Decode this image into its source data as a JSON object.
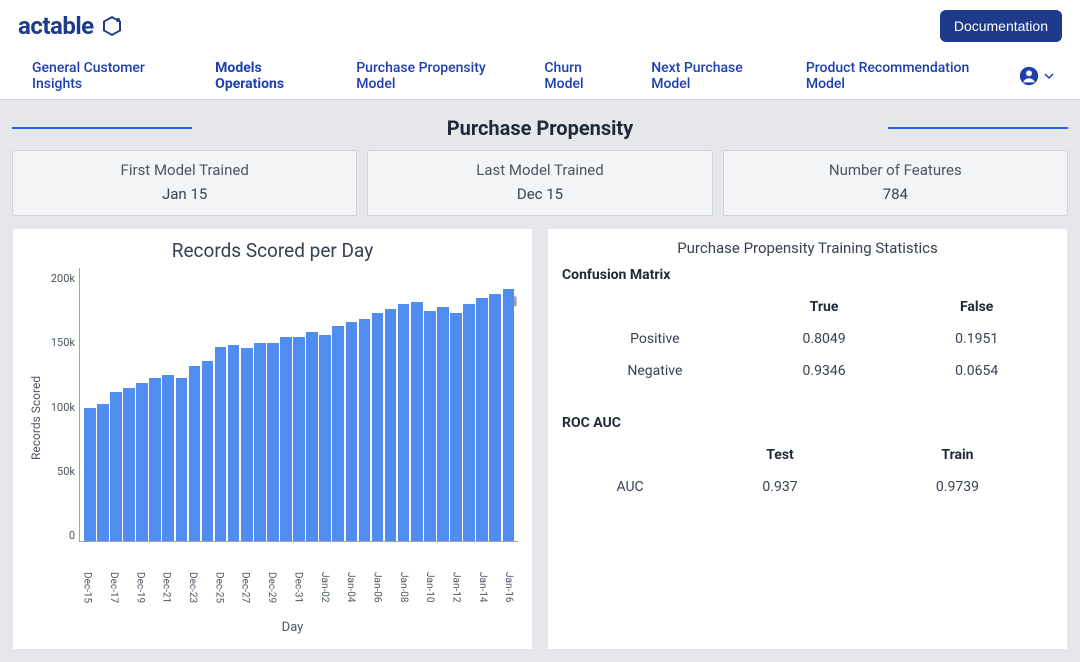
{
  "brand": "actable",
  "doc_button": "Documentation",
  "nav": [
    "General Customer Insights",
    "Models Operations",
    "Purchase Propensity Model",
    "Churn Model",
    "Next Purchase Model",
    "Product Recommendation Model"
  ],
  "nav_active_index": 1,
  "section_title": "Purchase Propensity",
  "stats": [
    {
      "label": "First Model Trained",
      "value": "Jan 15"
    },
    {
      "label": "Last Model Trained",
      "value": "Dec 15"
    },
    {
      "label": "Number of Features",
      "value": "784"
    }
  ],
  "chart_title": "Records Scored per Day",
  "chart_ylabel": "Records Scored",
  "chart_xlabel": "Day",
  "chart_y_ticks": [
    "200k",
    "150k",
    "100k",
    "50k",
    "0"
  ],
  "chart_data": {
    "type": "bar",
    "title": "Records Scored per Day",
    "xlabel": "Day",
    "ylabel": "Records Scored",
    "ylim": [
      0,
      210000
    ],
    "categories": [
      "Dec-15",
      "Dec-16",
      "Dec-17",
      "Dec-18",
      "Dec-19",
      "Dec-20",
      "Dec-21",
      "Dec-22",
      "Dec-23",
      "Dec-24",
      "Dec-25",
      "Dec-26",
      "Dec-27",
      "Dec-28",
      "Dec-29",
      "Dec-30",
      "Dec-31",
      "Jan-01",
      "Jan-02",
      "Jan-03",
      "Jan-04",
      "Jan-05",
      "Jan-06",
      "Jan-07",
      "Jan-08",
      "Jan-09",
      "Jan-10",
      "Jan-11",
      "Jan-12",
      "Jan-13",
      "Jan-14",
      "Jan-15",
      "Jan-16"
    ],
    "values": [
      102000,
      105000,
      114000,
      117000,
      121000,
      125000,
      127000,
      125000,
      134000,
      138000,
      149000,
      150000,
      148000,
      152000,
      152000,
      156000,
      156000,
      160000,
      158000,
      165000,
      168000,
      170000,
      175000,
      178000,
      182000,
      183000,
      176000,
      179000,
      175000,
      182000,
      186000,
      189000,
      193000
    ]
  },
  "training_stats_title": "Purchase Propensity Training Statistics",
  "confusion_label": "Confusion Matrix",
  "confusion_headers": [
    "",
    "True",
    "False"
  ],
  "confusion_rows": [
    {
      "label": "Positive",
      "true": "0.8049",
      "false": "0.1951"
    },
    {
      "label": "Negative",
      "true": "0.9346",
      "false": "0.0654"
    }
  ],
  "roc_label": "ROC AUC",
  "roc_headers": [
    "",
    "Test",
    "Train"
  ],
  "roc_rows": [
    {
      "label": "AUC",
      "test": "0.937",
      "train": "0.9739"
    }
  ]
}
